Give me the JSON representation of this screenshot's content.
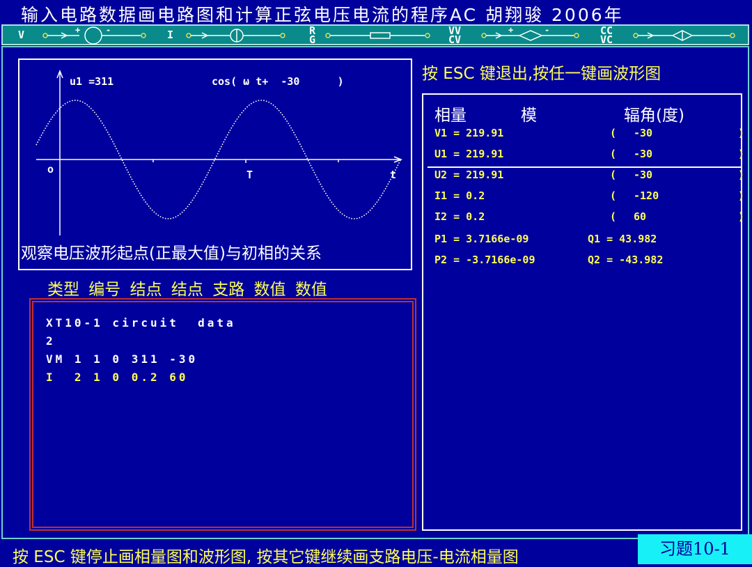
{
  "title": "输入电路数据画电路图和计算正弦电压电流的程序AC 胡翔骏 2006年",
  "toolbar": {
    "v_label": "V",
    "i_label": "I",
    "r_label": "R",
    "g_label": "G",
    "vv_label": "VV",
    "cv_label": "CV",
    "cc_label": "CC",
    "vc_label": "VC",
    "plus": "+",
    "minus": "-"
  },
  "waveform": {
    "amplitude_label": "u1  =311",
    "cos_label": "cos( ω t+  -30      )",
    "origin_label": "o",
    "period_label": "T",
    "time_label": "t"
  },
  "caption": "观察电压波形起点(正最大值)与初相的关系",
  "column_headers": "类型 编号 结点 结点 支路 数值 数值",
  "circuit_data": [
    {
      "text": "XT10-1 circuit  data",
      "color": "#ffffff"
    },
    {
      "text": "2",
      "color": "#ffffff"
    },
    {
      "text": "VM 1 1 0 311 -30",
      "color": "#ffffff"
    },
    {
      "text": "I  2 1 0 0.2 60",
      "color": "#ffff55"
    }
  ],
  "esc_hint": "按 ESC 键退出,按任一键画波形图",
  "phasor": {
    "head_phasor": "相量",
    "head_modulus": "模",
    "head_angle": "辐角(度)",
    "rows": [
      {
        "name": "V1 = 219.91",
        "open": "(",
        "angle": "-30",
        "close": ")"
      },
      {
        "name": "U1 = 219.91",
        "open": "(",
        "angle": "-30",
        "close": ")"
      },
      {
        "name": "U2 = 219.91",
        "open": "(",
        "angle": "-30",
        "close": ")"
      },
      {
        "name": "I1 = 0.2",
        "open": "(",
        "angle": "-120",
        "close": ")"
      },
      {
        "name": "I2 = 0.2",
        "open": "(",
        "angle": "60",
        "close": ")"
      }
    ],
    "power_rows": [
      {
        "p": "P1 = 3.7166e-09",
        "q": "Q1 = 43.982"
      },
      {
        "p": "P2 = -3.7166e-09",
        "q": "Q2 = -43.982"
      }
    ]
  },
  "bottom_hint": "按 ESC 键停止画相量图和波形图, 按其它键继续画支路电压-电流相量图",
  "exercise_tag": "习题10-1"
}
